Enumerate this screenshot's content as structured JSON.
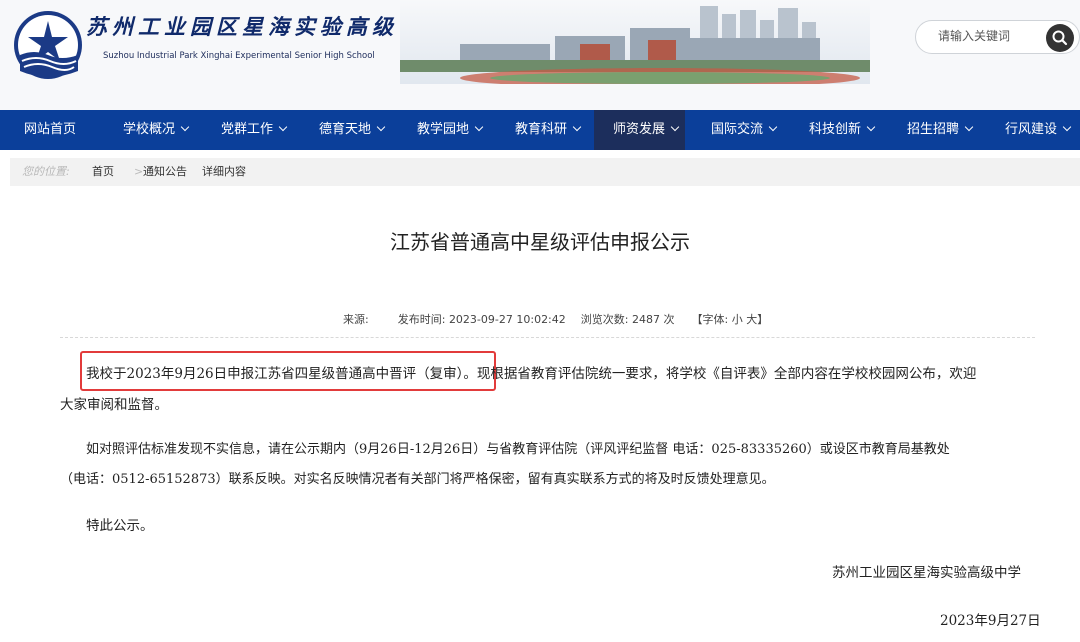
{
  "header": {
    "school_name_cn": "苏州工业园区星海实验高级中学",
    "school_name_en": "Suzhou Industrial Park Xinghai Experimental Senior High School",
    "search_placeholder": "请输入关键词",
    "logo_icon": "school-emblem-icon",
    "search_icon": "magnifier-icon"
  },
  "nav": {
    "items": [
      {
        "label": "网站首页",
        "has_dropdown": false
      },
      {
        "label": "学校概况",
        "has_dropdown": true
      },
      {
        "label": "党群工作",
        "has_dropdown": true
      },
      {
        "label": "德育天地",
        "has_dropdown": true
      },
      {
        "label": "教学园地",
        "has_dropdown": true
      },
      {
        "label": "教育科研",
        "has_dropdown": true
      },
      {
        "label": "师资发展",
        "has_dropdown": true,
        "active": true
      },
      {
        "label": "国际交流",
        "has_dropdown": true
      },
      {
        "label": "科技创新",
        "has_dropdown": true
      },
      {
        "label": "招生招聘",
        "has_dropdown": true
      },
      {
        "label": "行风建设",
        "has_dropdown": true
      }
    ]
  },
  "breadcrumb": {
    "prefix": "您的位置:",
    "home": "首页",
    "separator": ">",
    "category": "通知公告",
    "current": "详细内容"
  },
  "article": {
    "title": "江苏省普通高中星级评估申报公示",
    "meta": {
      "source_label": "来源:",
      "publish_label": "发布时间:",
      "publish_time": "2023-09-27 10:02:42",
      "views_label": "浏览次数:",
      "views": "2487",
      "views_unit": "次",
      "font_label": "【字体:",
      "font_small": "小",
      "font_large": "大】"
    },
    "paragraph1_highlight": "我校于2023年9月26日申报江苏省四星级普通高中晋评（复审）。",
    "paragraph1_rest": "现根据省教育评估院统一要求，将学校《自评表》全部内容在学校校园网公布，欢迎",
    "paragraph1_line2": "大家审阅和监督。",
    "paragraph2_line1": "如对照评估标准发现不实信息，请在公示期内（9月26日-12月26日）与省教育评估院（评风评纪监督  电话：025-83335260）或设区市教育局基教处",
    "paragraph2_line2": "（电话：0512-65152873）联系反映。对实名反映情况者有关部门将严格保密，留有真实联系方式的将及时反馈处理意见。",
    "paragraph3": "特此公示。",
    "signature": "苏州工业园区星海实验高级中学",
    "date": "2023年9月27日"
  },
  "colors": {
    "nav_bg": "#0b3f9a",
    "nav_active_bg": "#1c2e5c",
    "highlight_border": "#e23b3b"
  }
}
